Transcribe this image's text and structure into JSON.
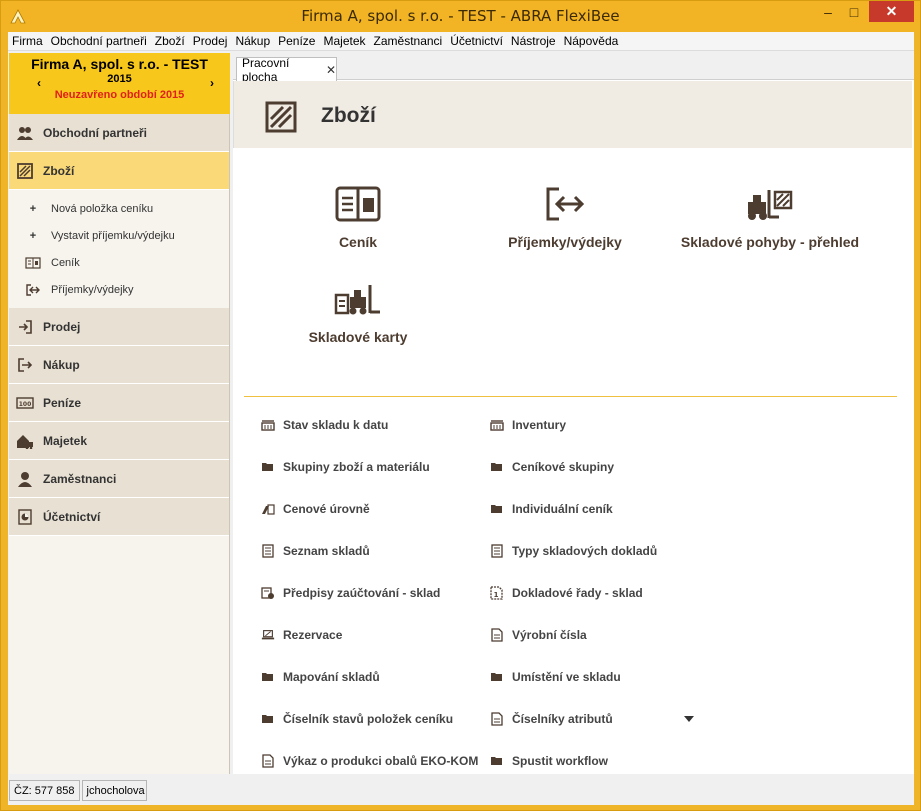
{
  "window": {
    "title": "Firma A, spol. s r.o. - TEST - ABRA FlexiBee",
    "minimize": "–",
    "maximize": "□",
    "close": "✕"
  },
  "menu": [
    "Firma",
    "Obchodní partneři",
    "Zboží",
    "Prodej",
    "Nákup",
    "Peníze",
    "Majetek",
    "Zaměstnanci",
    "Účetnictví",
    "Nástroje",
    "Nápověda"
  ],
  "company": {
    "name": "Firma A, spol. s r.o. - TEST",
    "year": "2015",
    "prev": "‹",
    "next": "›",
    "warning": "Neuzavřeno období 2015"
  },
  "sidebar": {
    "sections": [
      {
        "label": "Obchodní partneři",
        "icon": "partners-icon"
      },
      {
        "label": "Zboží",
        "icon": "goods-icon"
      },
      {
        "label": "Prodej",
        "icon": "sale-icon"
      },
      {
        "label": "Nákup",
        "icon": "purchase-icon"
      },
      {
        "label": "Peníze",
        "icon": "money-icon"
      },
      {
        "label": "Majetek",
        "icon": "property-icon"
      },
      {
        "label": "Zaměstnanci",
        "icon": "employee-icon"
      },
      {
        "label": "Účetnictví",
        "icon": "accounting-icon"
      }
    ],
    "subitems": [
      "Nová položka ceníku",
      "Vystavit příjemku/výdejku",
      "Ceník",
      "Příjemky/výdejky"
    ]
  },
  "tab": {
    "label": "Pracovní plocha",
    "close": "✕"
  },
  "page": {
    "title": "Zboží"
  },
  "tiles": [
    "Ceník",
    "Příjemky/výdejky",
    "Skladové pohyby - přehled",
    "Skladové karty"
  ],
  "links": {
    "left": [
      "Stav skladu k datu",
      "Skupiny zboží a materiálu",
      "Cenové úrovně",
      "Seznam skladů",
      "Předpisy zaúčtování - sklad",
      "Rezervace",
      "Mapování skladů",
      "Číselník stavů položek ceníku",
      "Výkaz o produkci obalů EKO-KOM"
    ],
    "right": [
      "Inventury",
      "Ceníkové skupiny",
      "Individuální ceník",
      "Typy skladových dokladů",
      "Dokladové řady - sklad",
      "Výrobní čísla",
      "Umístění ve skladu",
      "Číselníky atributů",
      "Spustit workflow"
    ]
  },
  "status": {
    "cz": "ČZ: 577 858",
    "user": "jchocholova"
  },
  "colors": {
    "accent": "#f2b425",
    "active": "#f9d978",
    "icon": "#4d3c30",
    "warning": "#e0201a"
  }
}
